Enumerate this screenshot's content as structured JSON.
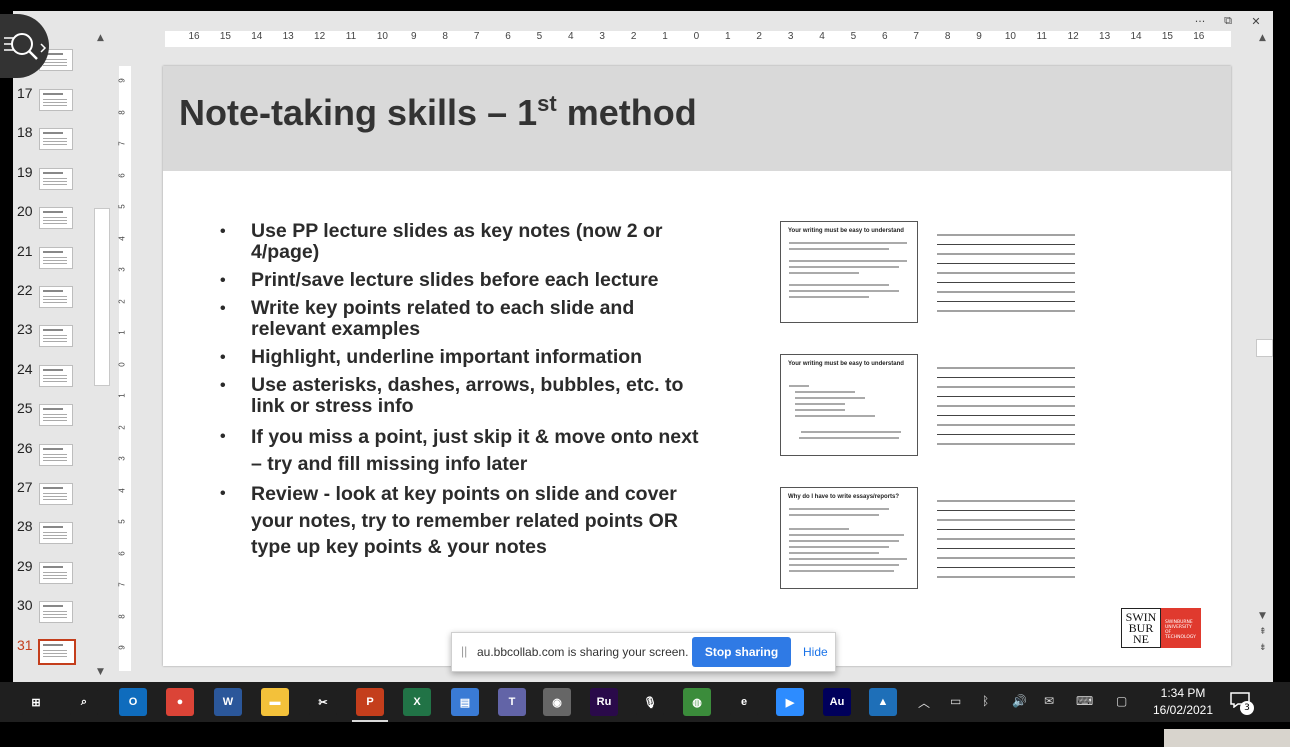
{
  "window": {
    "controls": [
      "···",
      "⧉",
      "✕"
    ]
  },
  "thumbnails": {
    "numbers": [
      "17",
      "18",
      "19",
      "20",
      "21",
      "22",
      "23",
      "24",
      "25",
      "26",
      "27",
      "28",
      "29",
      "30",
      "31"
    ],
    "active": "31"
  },
  "ruler_h_ticks": [
    "16",
    "15",
    "14",
    "13",
    "12",
    "11",
    "10",
    "9",
    "8",
    "7",
    "6",
    "5",
    "4",
    "3",
    "2",
    "1",
    "0",
    "1",
    "2",
    "3",
    "4",
    "5",
    "6",
    "7",
    "8",
    "9",
    "10",
    "11",
    "12",
    "13",
    "14",
    "15",
    "16"
  ],
  "ruler_v_ticks": [
    "9",
    "8",
    "7",
    "6",
    "5",
    "4",
    "3",
    "2",
    "1",
    "0",
    "1",
    "2",
    "3",
    "4",
    "5",
    "6",
    "7",
    "8",
    "9"
  ],
  "slide": {
    "title": "Note-taking skills – 1",
    "title_sup": "st",
    "title_suffix": " method",
    "bullets": [
      "Use PP lecture slides as key notes (now 2 or 4/page)",
      "Print/save lecture slides before each lecture",
      "Write key points related to each slide and relevant examples",
      "Highlight, underline important information",
      "Use asterisks, dashes, arrows, bubbles, etc. to link or stress info",
      "If you miss a point, just skip it & move onto next – try and fill missing info later",
      "Review - look at key points on slide and cover your notes, try to remember related points OR type up key points & your notes"
    ],
    "mini_slides": [
      {
        "title": "Your writing must be easy to understand"
      },
      {
        "title": "Your writing must be easy to understand"
      },
      {
        "title": "Why do I have to write essays/reports?"
      }
    ],
    "logo": {
      "left": "SWIN BUR NE",
      "right": "SWINBURNE UNIVERSITY OF TECHNOLOGY"
    }
  },
  "share_bar": {
    "text": "au.bbcollab.com is sharing your screen.",
    "stop_label": "Stop sharing",
    "hide_label": "Hide",
    "grip": "||"
  },
  "taskbar": {
    "apps": [
      {
        "name": "start",
        "glyph": "⊞",
        "color": "#1f1f1f"
      },
      {
        "name": "search",
        "glyph": "⌕",
        "color": "#1f1f1f"
      },
      {
        "name": "outlook",
        "glyph": "O",
        "color": "#0f6cbd"
      },
      {
        "name": "chrome",
        "glyph": "●",
        "color": "#db4437"
      },
      {
        "name": "word",
        "glyph": "W",
        "color": "#2b579a"
      },
      {
        "name": "file-explorer",
        "glyph": "▬",
        "color": "#f3c13a"
      },
      {
        "name": "snipping",
        "glyph": "✂",
        "color": "#1f1f1f"
      },
      {
        "name": "powerpoint",
        "glyph": "P",
        "color": "#c43e1c"
      },
      {
        "name": "excel",
        "glyph": "X",
        "color": "#217346"
      },
      {
        "name": "files",
        "glyph": "▤",
        "color": "#3a7bd5"
      },
      {
        "name": "teams",
        "glyph": "T",
        "color": "#6264a7"
      },
      {
        "name": "camera",
        "glyph": "◉",
        "color": "#666"
      },
      {
        "name": "rush",
        "glyph": "Ru",
        "color": "#2a0a4a"
      },
      {
        "name": "recorder",
        "glyph": "🎙",
        "color": "#1f1f1f"
      },
      {
        "name": "globe",
        "glyph": "◍",
        "color": "#3b8c3b"
      },
      {
        "name": "edge",
        "glyph": "e",
        "color": "#1f1f1f"
      },
      {
        "name": "zoom",
        "glyph": "▶",
        "color": "#2d8cff"
      },
      {
        "name": "audition",
        "glyph": "Au",
        "color": "#00005b"
      },
      {
        "name": "photos",
        "glyph": "▲",
        "color": "#1e6fb8"
      }
    ],
    "clock_time": "1:34 PM",
    "clock_date": "16/02/2021",
    "notification_count": "3"
  }
}
